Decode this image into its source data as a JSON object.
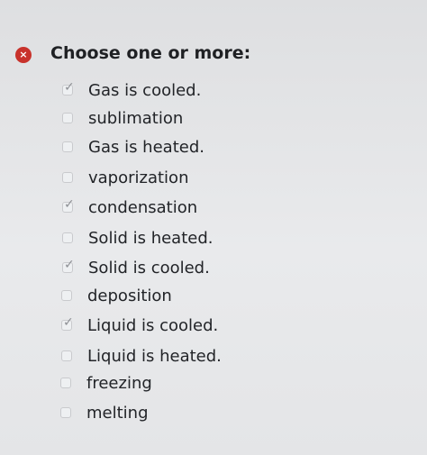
{
  "question": {
    "status": "incorrect",
    "prompt": "Choose one or more:",
    "error_icon": "×",
    "check_glyph": "✓",
    "options": [
      {
        "label": "Gas is cooled.",
        "checked": true
      },
      {
        "label": "sublimation",
        "checked": false
      },
      {
        "label": "Gas is heated.",
        "checked": false
      },
      {
        "label": "vaporization",
        "checked": false
      },
      {
        "label": "condensation",
        "checked": true
      },
      {
        "label": "Solid is heated.",
        "checked": false
      },
      {
        "label": "Solid is cooled.",
        "checked": true
      },
      {
        "label": "deposition",
        "checked": false
      },
      {
        "label": "Liquid is cooled.",
        "checked": true
      },
      {
        "label": "Liquid is heated.",
        "checked": false
      },
      {
        "label": "freezing",
        "checked": false
      },
      {
        "label": "melting",
        "checked": false
      }
    ]
  },
  "colors": {
    "error": "#c8322b",
    "checkmark": "#8e9095",
    "text": "#222428"
  }
}
